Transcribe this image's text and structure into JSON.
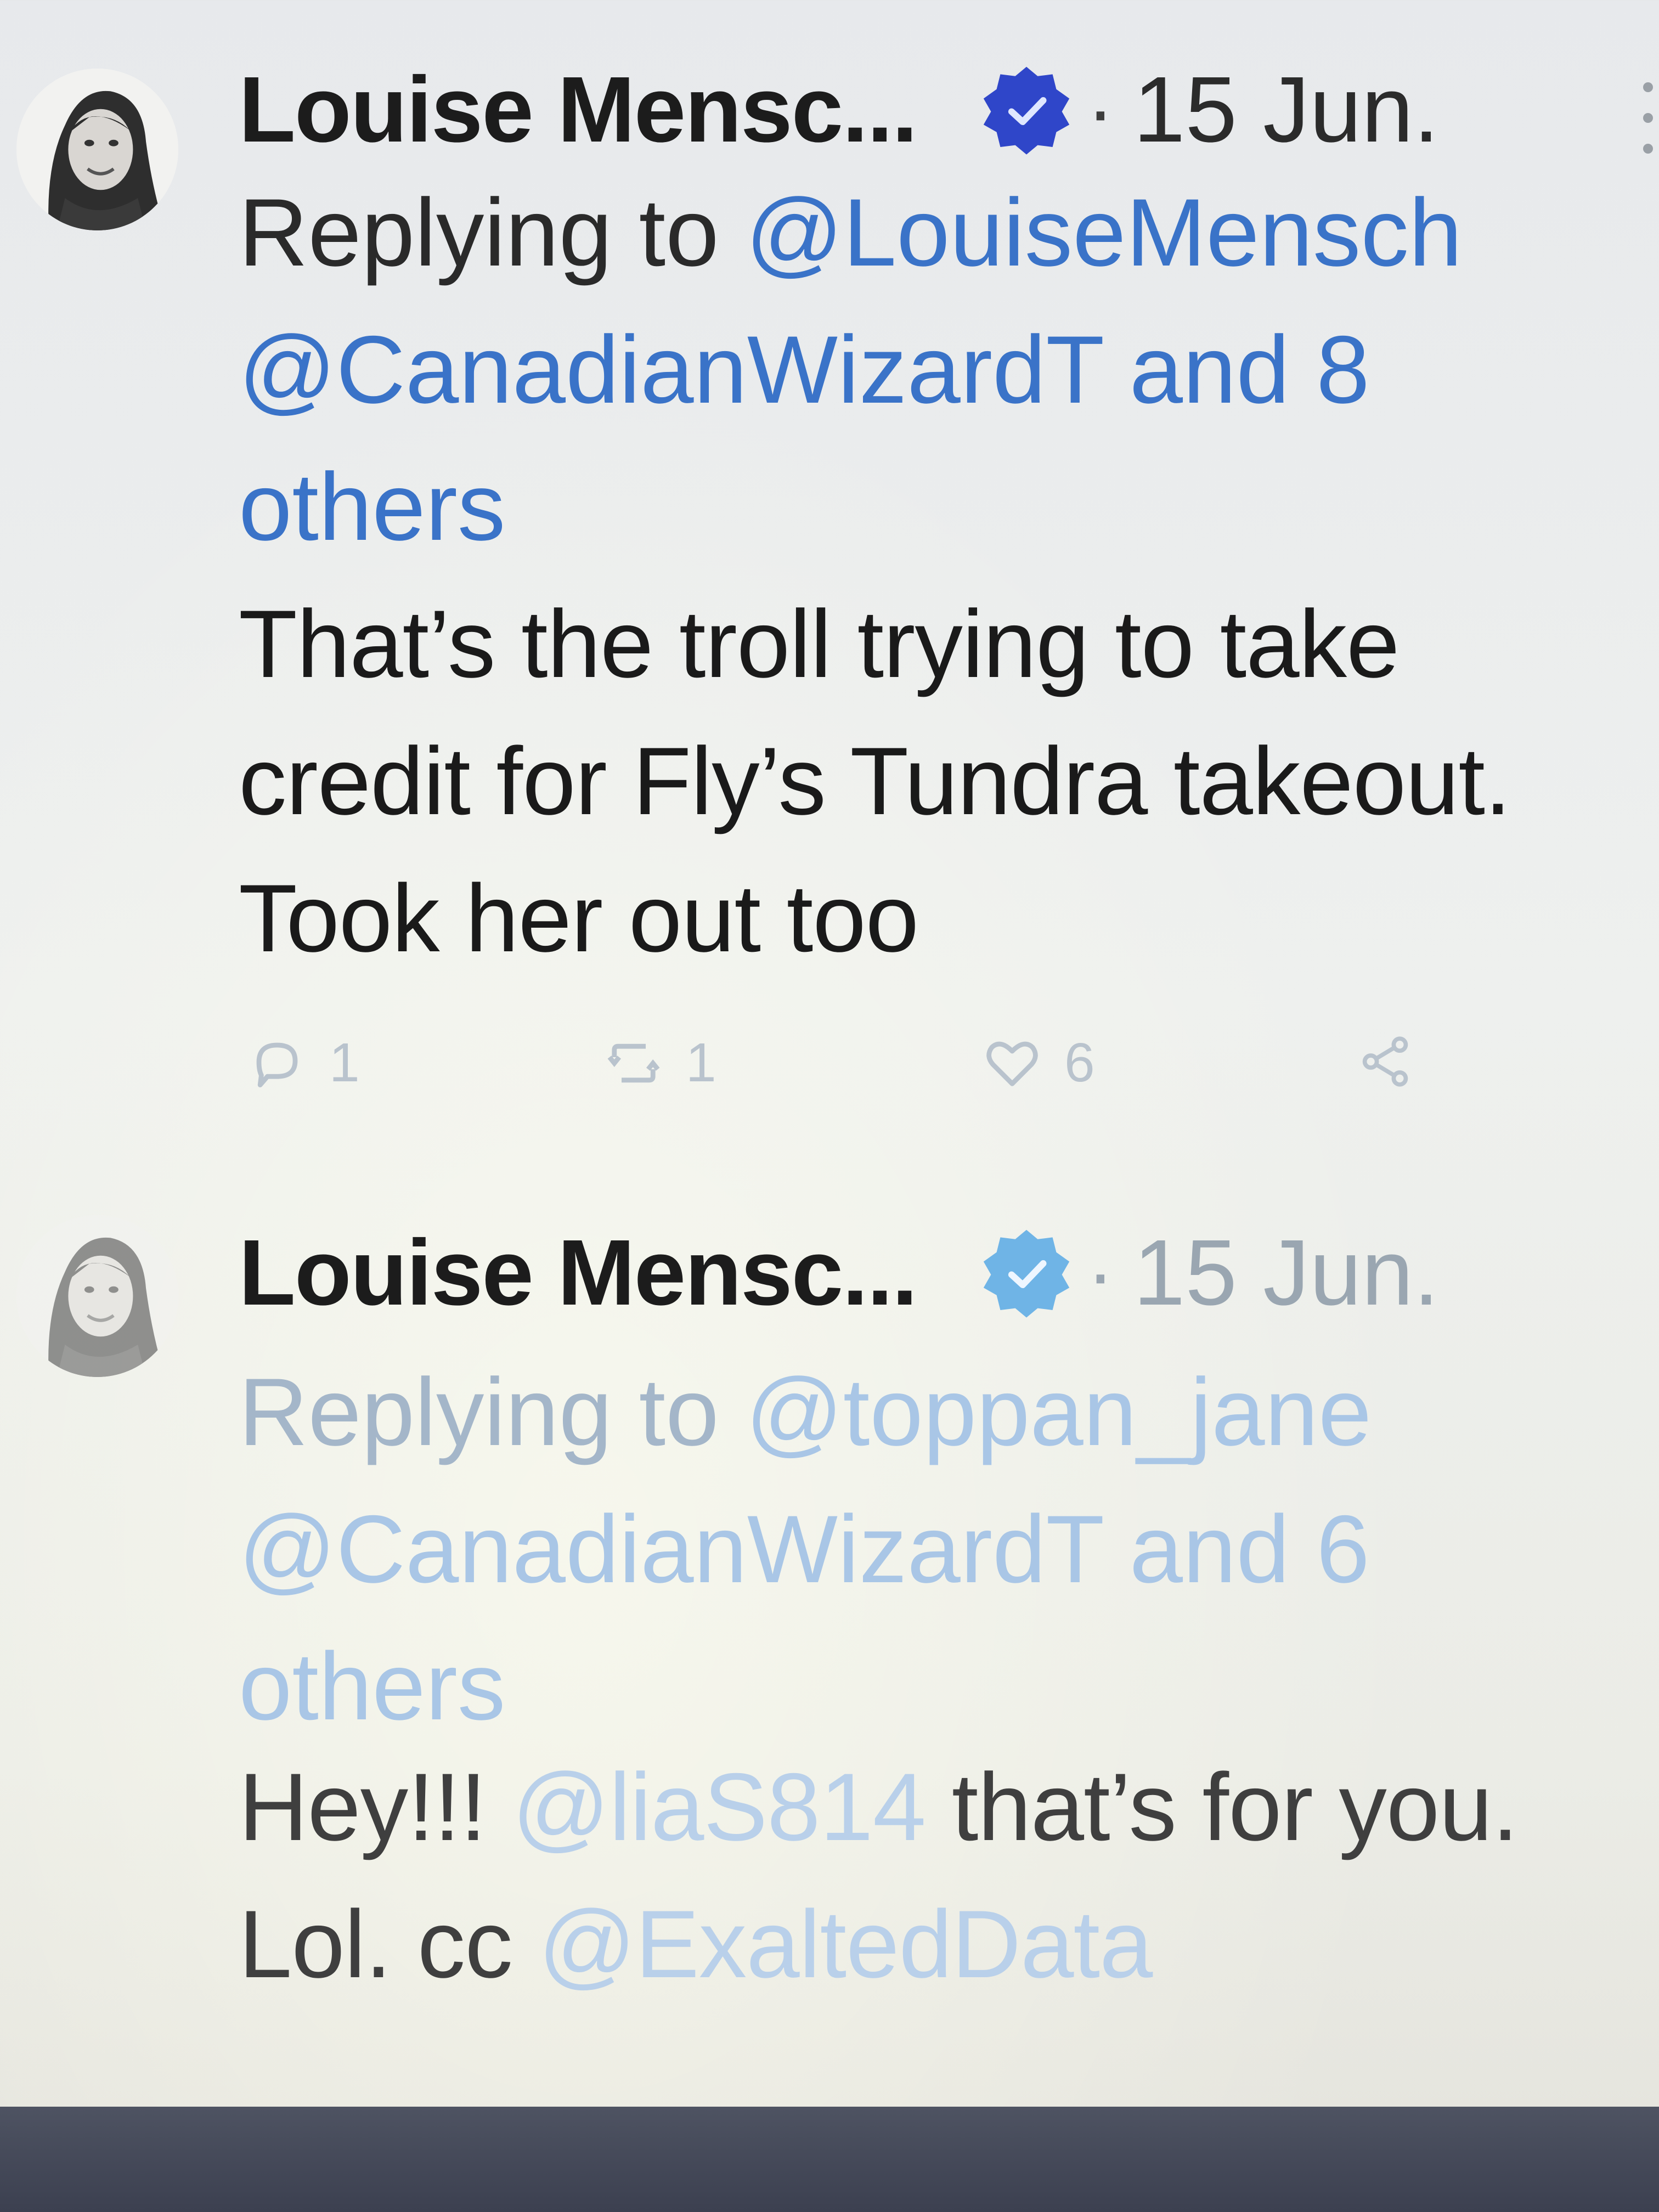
{
  "tweets": [
    {
      "author": "Louise Mensc...",
      "separator": "·",
      "date": "15 Jun.",
      "reply_prefix": "Replying to",
      "reply_mention_1": "@LouiseMensch",
      "reply_mention_2": "@CanadianWizardT",
      "reply_others": "and 8 others",
      "body_line_1": "That’s the troll trying to take",
      "body_line_2": "credit for Fly’s Tundra takeout.",
      "body_line_3": "Took her out too",
      "reply_count": "1",
      "retweet_count": "1",
      "like_count": "6"
    },
    {
      "author": "Louise Mensc...",
      "separator": "·",
      "date": "15 Jun.",
      "reply_prefix": "Replying to",
      "reply_mention_1": "@toppan_jane",
      "reply_mention_2": "@CanadianWizardT",
      "reply_others": "and 6 others",
      "body_hey": "Hey!!!",
      "body_mention_1": "@liaS814",
      "body_rest_1": "that’s for you.",
      "body_lol": "Lol. cc",
      "body_mention_2": "@ExaltedData"
    }
  ],
  "icons": {
    "verified": "verified-badge-icon",
    "reply": "reply-icon",
    "retweet": "retweet-icon",
    "like": "heart-icon",
    "share": "share-icon",
    "menu": "more-options-icon"
  },
  "colors": {
    "mention": "#3a73c8",
    "verified": "#2f46c9",
    "verified_faded": "#6fb4e6",
    "text": "#1a1a1a"
  }
}
